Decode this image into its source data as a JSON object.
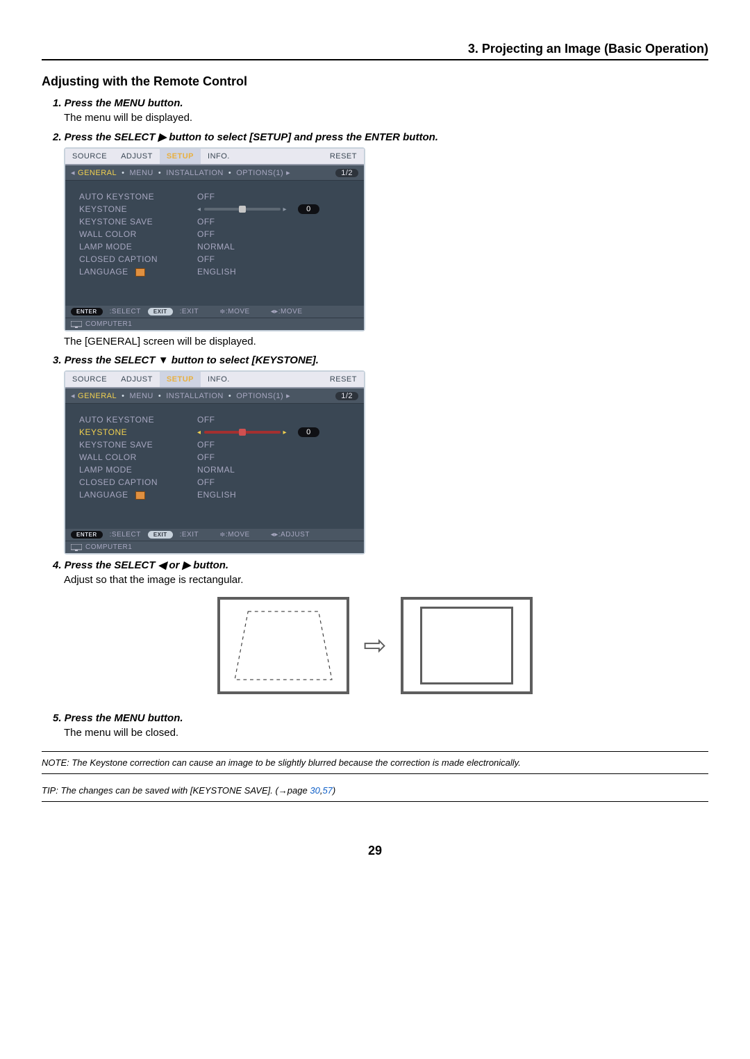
{
  "header": {
    "chapter": "3. Projecting an Image (Basic Operation)"
  },
  "section": {
    "title": "Adjusting with the Remote Control"
  },
  "steps": {
    "s1": {
      "label": "1.  Press the MENU button.",
      "body": "The menu will be displayed."
    },
    "s2": {
      "label": "2.  Press the SELECT ▶ button to select [SETUP] and press the ENTER button."
    },
    "s2_after": "The [GENERAL] screen will be displayed.",
    "s3": {
      "label": "3.  Press the SELECT ▼ button to select [KEYSTONE]."
    },
    "s4": {
      "label": "4.  Press the SELECT ◀ or ▶ button.",
      "body": "Adjust so that the image is rectangular."
    },
    "s5": {
      "label": "5.  Press the MENU button.",
      "body": "The menu will be closed."
    }
  },
  "menu": {
    "tabs": {
      "source": "SOURCE",
      "adjust": "ADJUST",
      "setup": "SETUP",
      "info": "INFO.",
      "reset": "RESET"
    },
    "subtabs": {
      "general": "GENERAL",
      "menu": "MENU",
      "installation": "INSTALLATION",
      "options1": "OPTIONS(1)",
      "pager": "1/2"
    },
    "items": {
      "auto_keystone": {
        "label": "AUTO KEYSTONE",
        "value": "OFF"
      },
      "keystone": {
        "label": "KEYSTONE",
        "value": "0"
      },
      "keystone_save": {
        "label": "KEYSTONE SAVE",
        "value": "OFF"
      },
      "wall_color": {
        "label": "WALL COLOR",
        "value": "OFF"
      },
      "lamp_mode": {
        "label": "LAMP MODE",
        "value": "NORMAL"
      },
      "closed_caption": {
        "label": "CLOSED CAPTION",
        "value": "OFF"
      },
      "language": {
        "label": "LANGUAGE",
        "value": "ENGLISH"
      }
    },
    "footer": {
      "enter_pill": "ENTER",
      "enter": ":SELECT",
      "exit_pill": "EXIT",
      "exit": ":EXIT",
      "updown": "≑:MOVE",
      "lr_move": "◂▸:MOVE",
      "lr_adjust": "◂▸:ADJUST",
      "source": "COMPUTER1"
    }
  },
  "note": "NOTE: The Keystone correction can cause an image to be slightly blurred because the correction is made electronically.",
  "tip": {
    "text": "TIP: The changes can be saved with [KEYSTONE SAVE]. (→page ",
    "p1": "30",
    "comma": ",",
    "p2": "57",
    "close": ")"
  },
  "page_number": "29"
}
